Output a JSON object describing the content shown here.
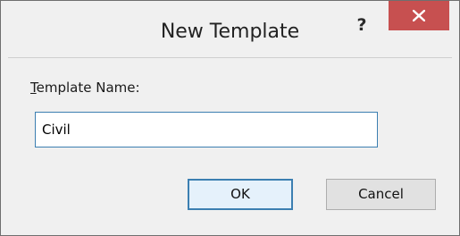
{
  "window": {
    "title": "New Template",
    "help_label": "?",
    "close_icon": "close-icon"
  },
  "form": {
    "label_accel": "T",
    "label_rest": "emplate Name:",
    "template_name_value": "Civil"
  },
  "buttons": {
    "ok_label": "OK",
    "cancel_label": "Cancel"
  },
  "colors": {
    "close_button_bg": "#c75050",
    "focus_border": "#3c7fb1"
  }
}
